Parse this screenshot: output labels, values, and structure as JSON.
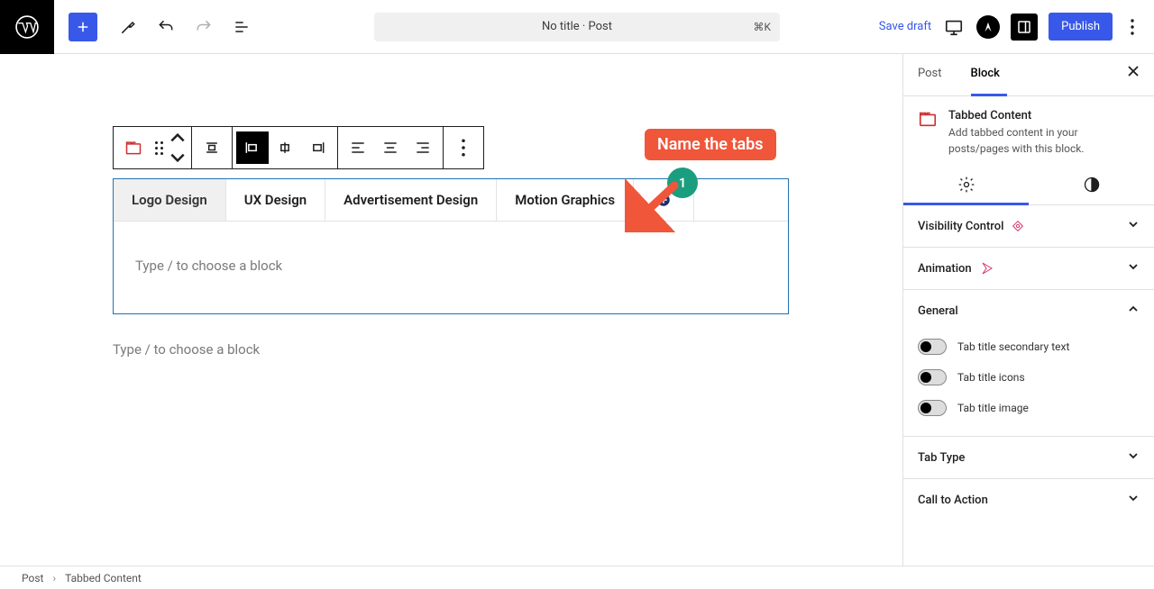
{
  "topbar": {
    "doc_title": "No title · Post",
    "kbd_hint": "⌘K",
    "save_draft": "Save draft",
    "publish": "Publish"
  },
  "breadcrumb": {
    "item1": "Post",
    "item2": "Tabbed Content"
  },
  "block_toolbar": {
    "icon_color": "#cf2e2e"
  },
  "tabbed": {
    "tabs": [
      {
        "label": "Logo Design"
      },
      {
        "label": "UX Design"
      },
      {
        "label": "Advertisement Design"
      },
      {
        "label": "Motion Graphics"
      }
    ],
    "content_placeholder": "Type / to choose a block",
    "after_placeholder": "Type / to choose a block"
  },
  "annotation": {
    "text": "Name the tabs",
    "badge": "1"
  },
  "sidebar": {
    "tab_post": "Post",
    "tab_block": "Block",
    "block_title": "Tabbed Content",
    "block_desc": "Add tabbed content in your posts/pages with this block.",
    "panels": {
      "visibility": "Visibility Control",
      "animation": "Animation",
      "general": "General",
      "tab_type": "Tab Type",
      "cta": "Call to Action"
    },
    "general_toggles": {
      "secondary_text": "Tab title secondary text",
      "icons": "Tab title icons",
      "image": "Tab title image"
    }
  }
}
